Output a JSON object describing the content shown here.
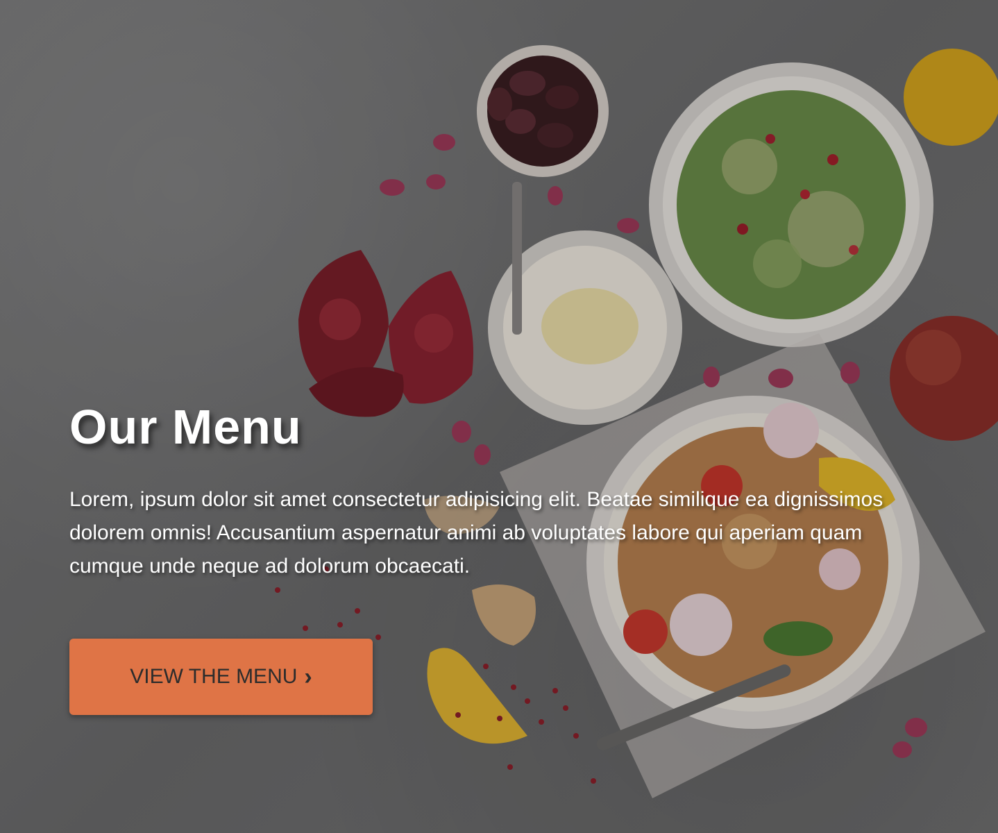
{
  "hero": {
    "title": "Our Menu",
    "description": "Lorem, ipsum dolor sit amet consectetur adipisicing elit. Beatae similique ea dignissimos dolorem omnis! Accusantium aspernatur animi ab voluptates labore qui aperiam quam cumque unde neque ad dolorum obcaecati.",
    "cta_label": "VIEW THE MENU",
    "cta_icon": "chevron-right-icon",
    "accent_color": "#df7446"
  }
}
